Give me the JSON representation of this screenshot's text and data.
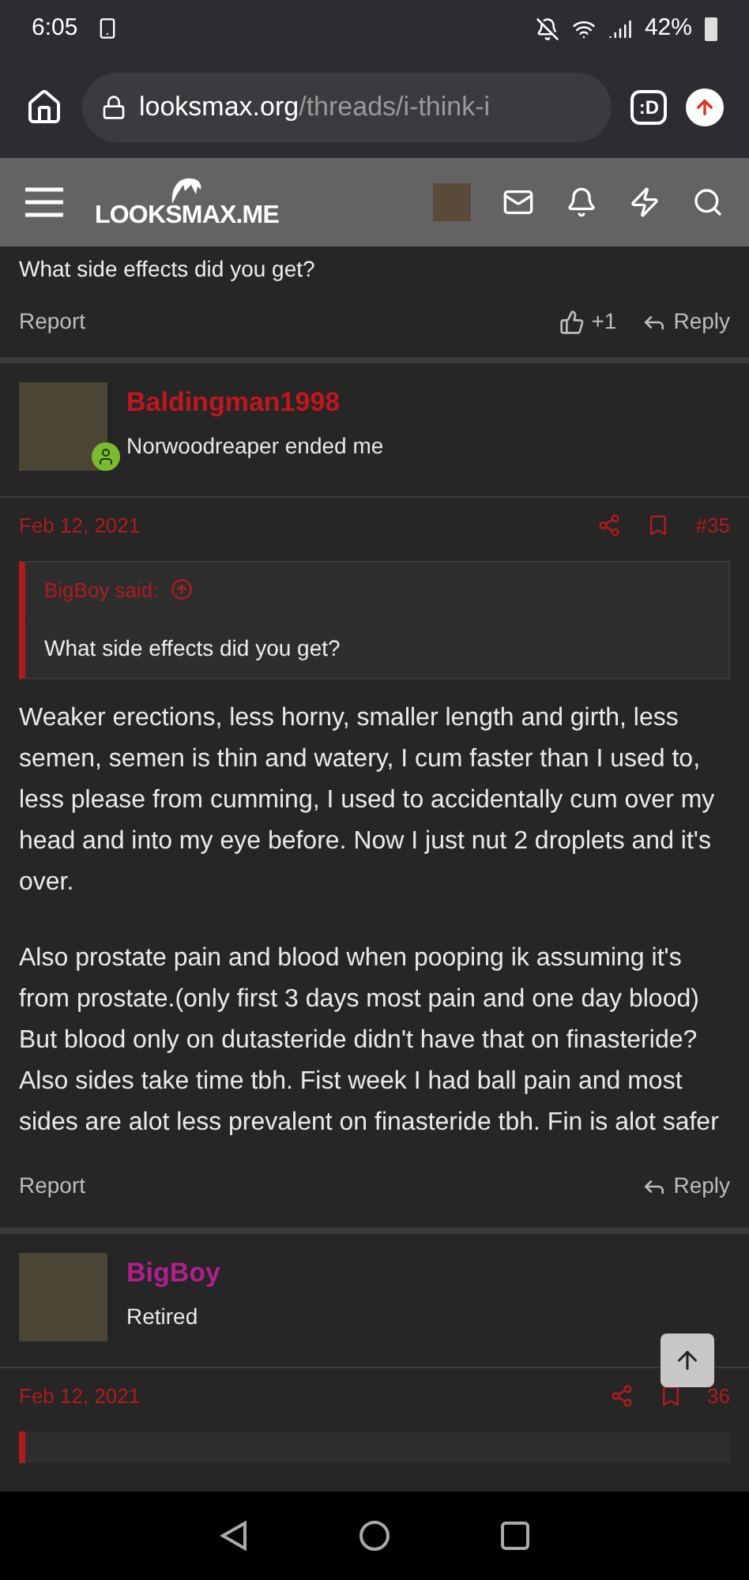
{
  "status_bar": {
    "time": "6:05",
    "battery": "42%"
  },
  "browser": {
    "url_domain": "looksmax.org",
    "url_path": "/threads/i-think-i",
    "tab_icon": ":D"
  },
  "site_header": {
    "logo": "LOOKSMAX.ME"
  },
  "prev_post": {
    "text": "What side effects did you get?",
    "report": "Report",
    "like_count": "+1",
    "reply": "Reply"
  },
  "posts": [
    {
      "username": "Baldingman1998",
      "color": "#c0161e",
      "user_title": "Norwoodreaper ended me",
      "online": true,
      "date": "Feb 12, 2021",
      "number": "#35",
      "quote": {
        "author": "BigBoy said:",
        "text": "What side effects did you get?"
      },
      "paragraphs": [
        "Weaker erections, less horny, smaller length and girth, less semen, semen is thin and watery, I cum faster than I used to, less please from cumming, I used to accidentally cum over my head and into my eye before. Now I just nut 2 droplets and it's over.",
        "Also prostate pain and blood when pooping ik assuming it's from prostate.(only first 3 days most pain and one day blood) But blood only on dutasteride didn't have that on finasteride? Also sides take time tbh. Fist week I had ball pain and most sides are alot less prevalent on finasteride tbh. Fin is alot safer"
      ],
      "report": "Report",
      "reply": "Reply"
    },
    {
      "username": "BigBoy",
      "color": "#b0208c",
      "user_title": "Retired",
      "online": false,
      "date": "Feb 12, 2021",
      "number": "36"
    }
  ]
}
